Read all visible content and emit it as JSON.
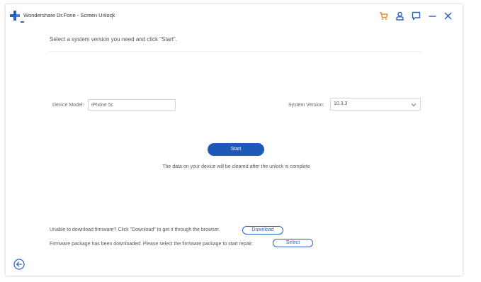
{
  "app": {
    "title": "Wondershare Dr.Fone - Screen Unlock"
  },
  "titlebar_icons": [
    "cart-icon",
    "user-icon",
    "feedback-icon",
    "minimize-icon",
    "close-icon"
  ],
  "colors": {
    "accent": "#1d5ab8",
    "icon_orange": "#f08a24",
    "icon_blue": "#2b5fc7",
    "logo_blue": "#2b5fc7"
  },
  "main": {
    "intro": "Select a system version you need and click \"Start\".",
    "device_model_label": "Device Model:",
    "device_model_value": "iPhone 5c",
    "system_version_label": "System Version:",
    "system_version_value": "10.3.3",
    "start_label": "Start",
    "warning": "The data on your device will be cleared after the unlock is complete"
  },
  "footer": {
    "download_note": "Unable to download firmware? Click \"Download\" to get it through the browser.",
    "download_label": "Download",
    "select_note": "Firmware package has been downloaded. Please select the firmware package to start repair.",
    "select_label": "Select"
  }
}
